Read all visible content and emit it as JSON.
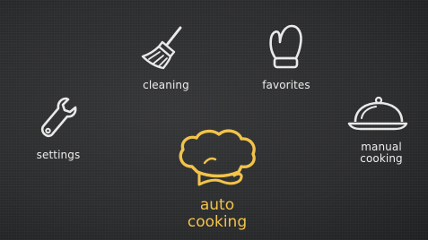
{
  "menu": {
    "settings": {
      "label": "settings",
      "icon": "wrench-icon"
    },
    "cleaning": {
      "label": "cleaning",
      "icon": "brush-icon"
    },
    "favorites": {
      "label": "favorites",
      "icon": "oven-mitt-icon"
    },
    "manual_cooking": {
      "label_line1": "manual",
      "label_line2": "cooking",
      "icon": "cloche-icon"
    },
    "auto_cooking": {
      "label_line1": "auto",
      "label_line2": "cooking",
      "icon": "chef-hat-icon",
      "highlighted": true
    }
  },
  "colors": {
    "background": "#2e2f30",
    "icon": "#e9e9e9",
    "highlight": "#f2c34b"
  }
}
